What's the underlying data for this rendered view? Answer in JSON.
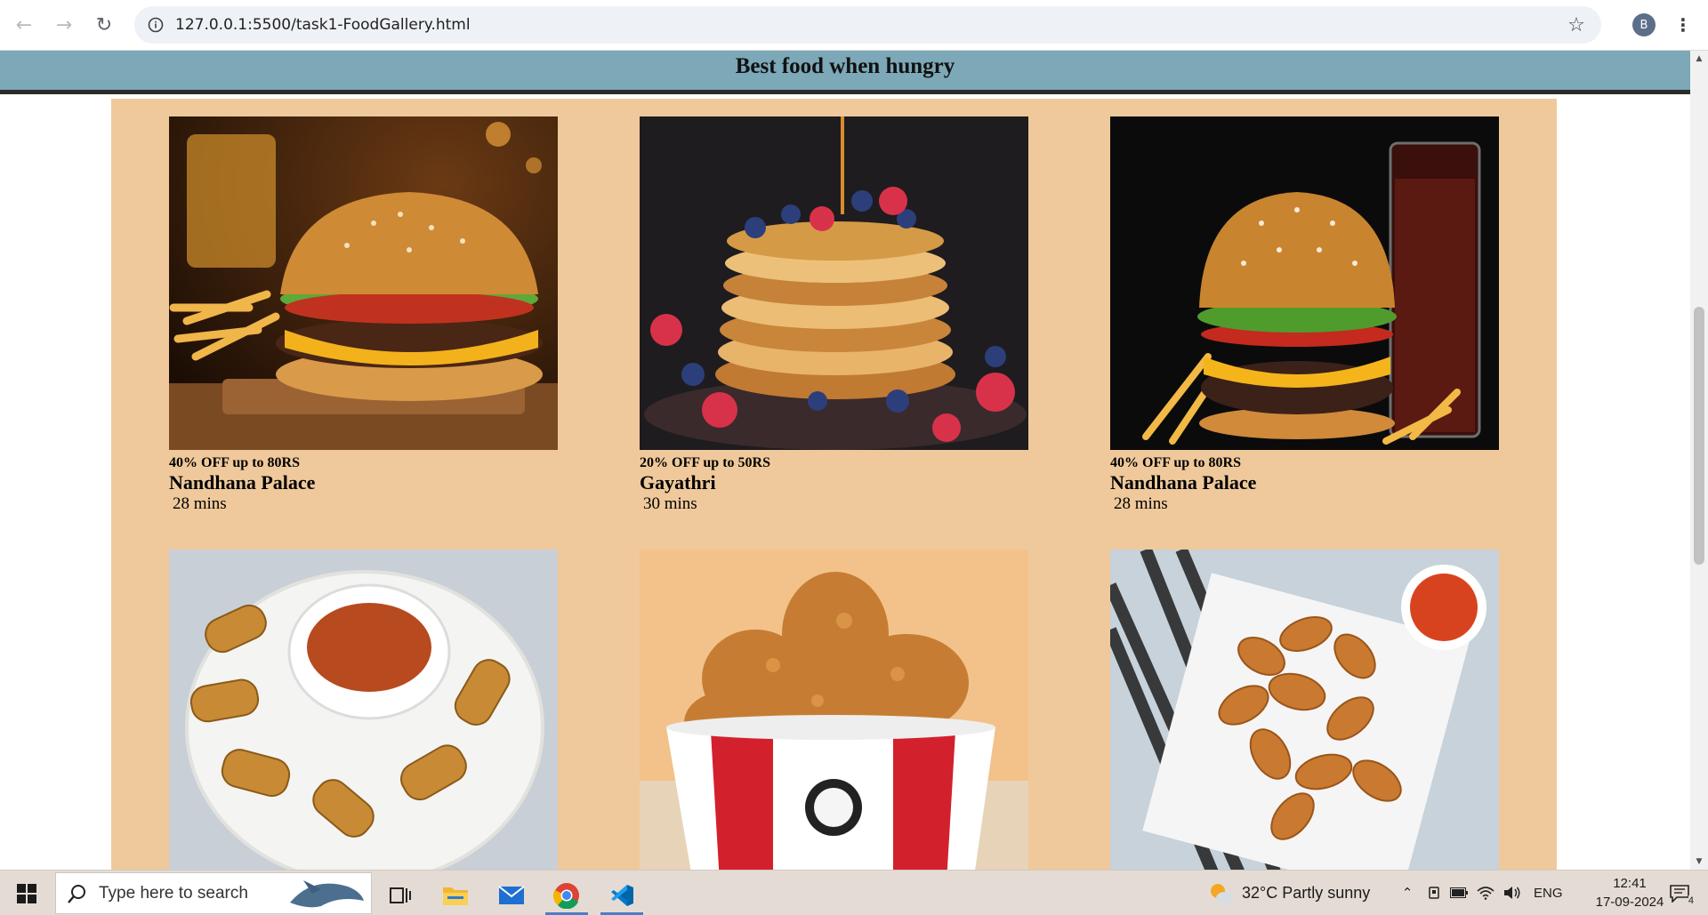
{
  "browser": {
    "url": "127.0.0.1:5500/task1-FoodGallery.html",
    "profile_initial": "B",
    "back_icon": "back-arrow-icon",
    "forward_icon": "forward-arrow-icon",
    "reload_icon": "reload-icon",
    "bookmark_icon": "star-icon",
    "menu_icon": "kebab-menu-icon"
  },
  "page": {
    "title": "Best food when hungry",
    "header_color": "#7ca8b8",
    "gallery_color": "#efc99b",
    "cards": [
      {
        "offer": "40% OFF up to 80RS",
        "name": "Nandhana Palace",
        "time": "28 mins",
        "image": "burger-with-fries-photo"
      },
      {
        "offer": "20% OFF up to 50RS",
        "name": "Gayathri",
        "time": "30 mins",
        "image": "pancake-stack-photo"
      },
      {
        "offer": "40% OFF up to 80RS",
        "name": "Nandhana Palace",
        "time": "28 mins",
        "image": "burger-with-cola-photo"
      },
      {
        "image": "spring-rolls-photo"
      },
      {
        "image": "fried-chicken-bucket-photo"
      },
      {
        "image": "chicken-nuggets-photo"
      }
    ]
  },
  "taskbar": {
    "search_placeholder": "Type here to search",
    "weather": "32°C  Partly sunny",
    "language": "ENG",
    "time": "12:41",
    "date": "17-09-2024",
    "notification_count": "4"
  }
}
